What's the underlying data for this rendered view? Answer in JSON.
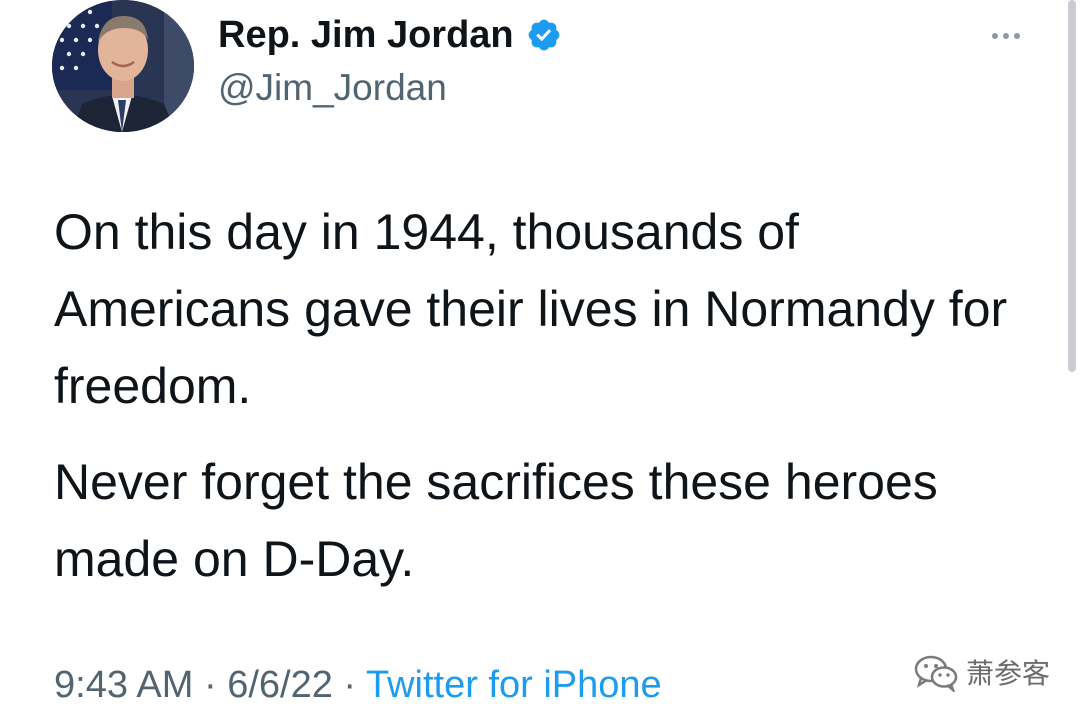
{
  "author": {
    "display_name": "Rep. Jim Jordan",
    "handle": "@Jim_Jordan",
    "verified": true,
    "avatar_icon": "profile-photo"
  },
  "tweet": {
    "paragraphs": [
      "On this day in 1944, thousands of Americans gave their lives in Normandy for freedom.",
      "Never forget the sacrifices these heroes made on D-Day."
    ],
    "time": "9:43 AM",
    "date": "6/6/22",
    "separator": "·",
    "source": "Twitter for iPhone"
  },
  "watermark": {
    "text": "萧参客",
    "icon": "wechat-icon"
  },
  "colors": {
    "text": "#0f1419",
    "muted": "#536471",
    "accent": "#1d9bf0"
  }
}
